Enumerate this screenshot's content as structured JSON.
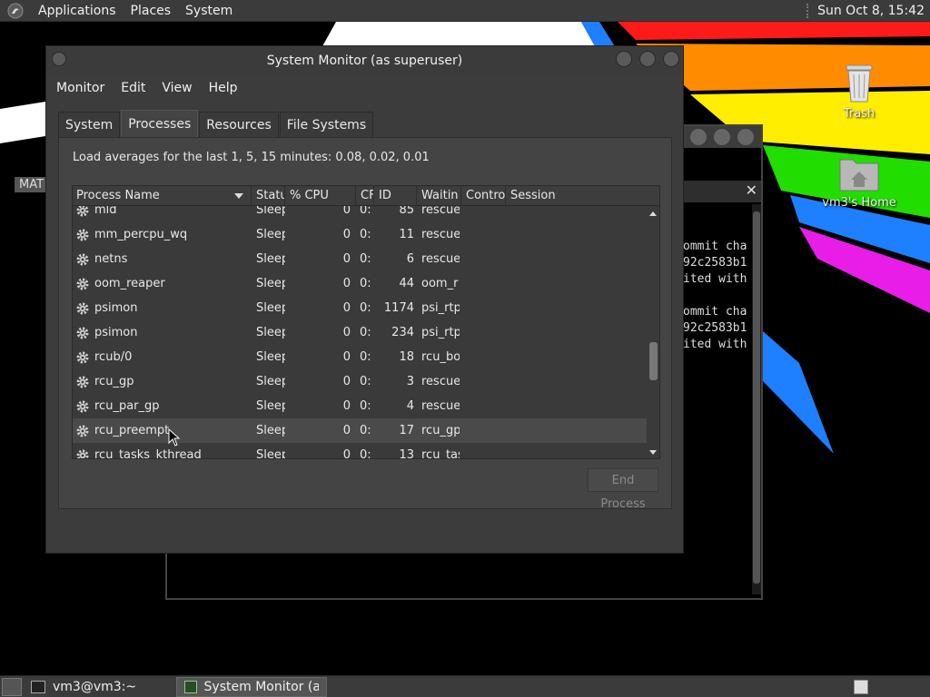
{
  "top_panel": {
    "menus": [
      "Applications",
      "Places",
      "System"
    ],
    "clock": "Sun Oct  8, 15:42"
  },
  "desktop": {
    "icons": [
      {
        "label": "Trash",
        "icon": "trash-icon"
      },
      {
        "label": "vm3's Home",
        "icon": "home-folder-icon"
      }
    ],
    "mat_label": "MAT"
  },
  "terminal": {
    "lines": [
      "ommit cha",
      "92c2583b1",
      "ited with",
      "",
      "ommit cha",
      "92c2583b1",
      "ited with"
    ]
  },
  "sysmon": {
    "title": "System Monitor (as superuser)",
    "menus": [
      "Monitor",
      "Edit",
      "View",
      "Help"
    ],
    "tabs": [
      "System",
      "Processes",
      "Resources",
      "File Systems"
    ],
    "active_tab": "Processes",
    "load_averages": "Load averages for the last 1, 5, 15 minutes: 0.08, 0.02, 0.01",
    "columns": [
      "Process Name",
      "Statu",
      "% CPU",
      "CF",
      "ID",
      "Waitin",
      "Contro",
      "Session"
    ],
    "rows": [
      {
        "name": "mld",
        "status": "Sleep",
        "cpu": "0",
        "cputime": "0:",
        "pid": "85",
        "wait": "rescuer"
      },
      {
        "name": "mm_percpu_wq",
        "status": "Sleep",
        "cpu": "0",
        "cputime": "0:",
        "pid": "11",
        "wait": "rescuer"
      },
      {
        "name": "netns",
        "status": "Sleep",
        "cpu": "0",
        "cputime": "0:",
        "pid": "6",
        "wait": "rescuer"
      },
      {
        "name": "oom_reaper",
        "status": "Sleep",
        "cpu": "0",
        "cputime": "0:",
        "pid": "44",
        "wait": "oom_r"
      },
      {
        "name": "psimon",
        "status": "Sleep",
        "cpu": "0",
        "cputime": "0:",
        "pid": "1174",
        "wait": "psi_rtp"
      },
      {
        "name": "psimon",
        "status": "Sleep",
        "cpu": "0",
        "cputime": "0:",
        "pid": "234",
        "wait": "psi_rtp"
      },
      {
        "name": "rcub/0",
        "status": "Sleep",
        "cpu": "0",
        "cputime": "0:",
        "pid": "18",
        "wait": "rcu_bo"
      },
      {
        "name": "rcu_gp",
        "status": "Sleep",
        "cpu": "0",
        "cputime": "0:",
        "pid": "3",
        "wait": "rescuer"
      },
      {
        "name": "rcu_par_gp",
        "status": "Sleep",
        "cpu": "0",
        "cputime": "0:",
        "pid": "4",
        "wait": "rescuer"
      },
      {
        "name": "rcu_preempt",
        "status": "Sleep",
        "cpu": "0",
        "cputime": "0:",
        "pid": "17",
        "wait": "rcu_gp"
      },
      {
        "name": "rcu_tasks_kthread",
        "status": "Sleep",
        "cpu": "0",
        "cputime": "0:",
        "pid": "13",
        "wait": "rcu_tas"
      }
    ],
    "end_process": "End Process"
  },
  "taskbar": {
    "tasks": [
      "vm3@vm3:~",
      "System Monitor (as ..."
    ],
    "active_task": 1
  },
  "colors": {
    "panel": "#3b3b3b",
    "window": "#3c3c3c",
    "stripe_red": "#ff1a1a",
    "stripe_orange": "#ff8c00",
    "stripe_yellow": "#ffee00",
    "stripe_green": "#22dd00",
    "stripe_blue": "#1e7fff",
    "stripe_magenta": "#e81ee8"
  }
}
